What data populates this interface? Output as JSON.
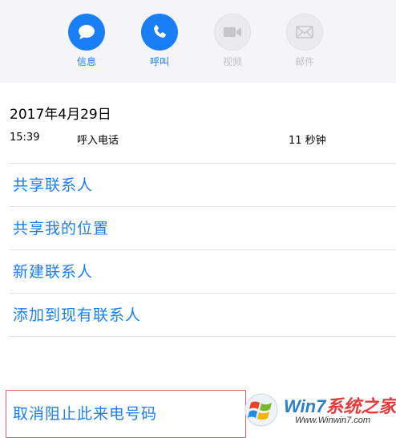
{
  "actions": [
    {
      "label": "信息",
      "icon": "message-bubble-icon",
      "enabled": true
    },
    {
      "label": "呼叫",
      "icon": "phone-icon",
      "enabled": true
    },
    {
      "label": "视频",
      "icon": "video-camera-icon",
      "enabled": false
    },
    {
      "label": "邮件",
      "icon": "mail-envelope-icon",
      "enabled": false
    }
  ],
  "call_log": {
    "date": "2017年4月29日",
    "time": "15:39",
    "type": "呼入电话",
    "duration": "11 秒钟"
  },
  "options": [
    "共享联系人",
    "共享我的位置",
    "新建联系人",
    "添加到现有联系人"
  ],
  "unblock": "取消阻止此来电号码",
  "watermark": {
    "brand_prefix": "Win7",
    "brand_suffix": "系统之家",
    "url": "Www.Winwin7.com"
  },
  "colors": {
    "accent": "#1a7ef7",
    "disabled": "#c0c0c4",
    "highlight_box": "#e06060"
  }
}
